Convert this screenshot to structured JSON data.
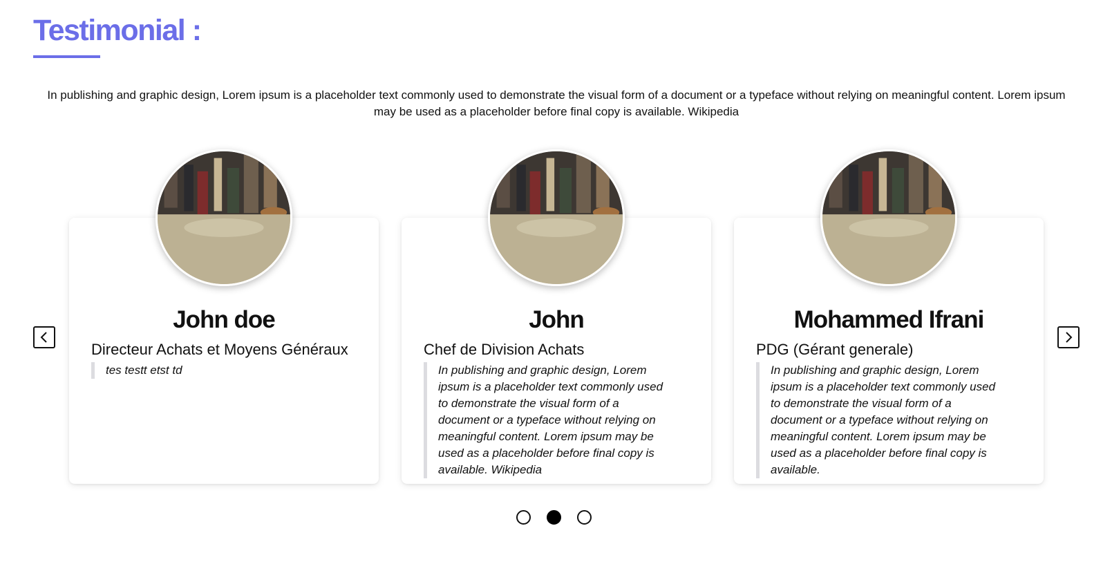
{
  "section": {
    "heading": "Testimonial :",
    "intro": "In publishing and graphic design, Lorem ipsum is a placeholder text commonly used to demonstrate the visual form of a document or a typeface without relying on meaningful content. Lorem ipsum may be used as a placeholder before final copy is available. Wikipedia",
    "accent_color": "#6b6ee8"
  },
  "testimonials": [
    {
      "name": "John doe",
      "role": "Directeur Achats et Moyens Généraux",
      "quote": "tes testt etst td"
    },
    {
      "name": "John",
      "role": "Chef de Division Achats",
      "quote": "In publishing and graphic design, Lorem ipsum is a placeholder text commonly used to demonstrate the visual form of a document or a typeface without relying on meaningful content. Lorem ipsum may be used as a placeholder before final copy is available. Wikipedia"
    },
    {
      "name": "Mohammed Ifrani",
      "role": "PDG (Gérant generale)",
      "quote": "In publishing and graphic design, Lorem ipsum is a placeholder text commonly used to demonstrate the visual form of a document or a typeface without relying on meaningful content. Lorem ipsum may be used as a placeholder before final copy is available."
    }
  ],
  "carousel": {
    "prev_icon": "chevron-left-icon",
    "next_icon": "chevron-right-icon",
    "active_page": 2,
    "page_count": 3
  }
}
